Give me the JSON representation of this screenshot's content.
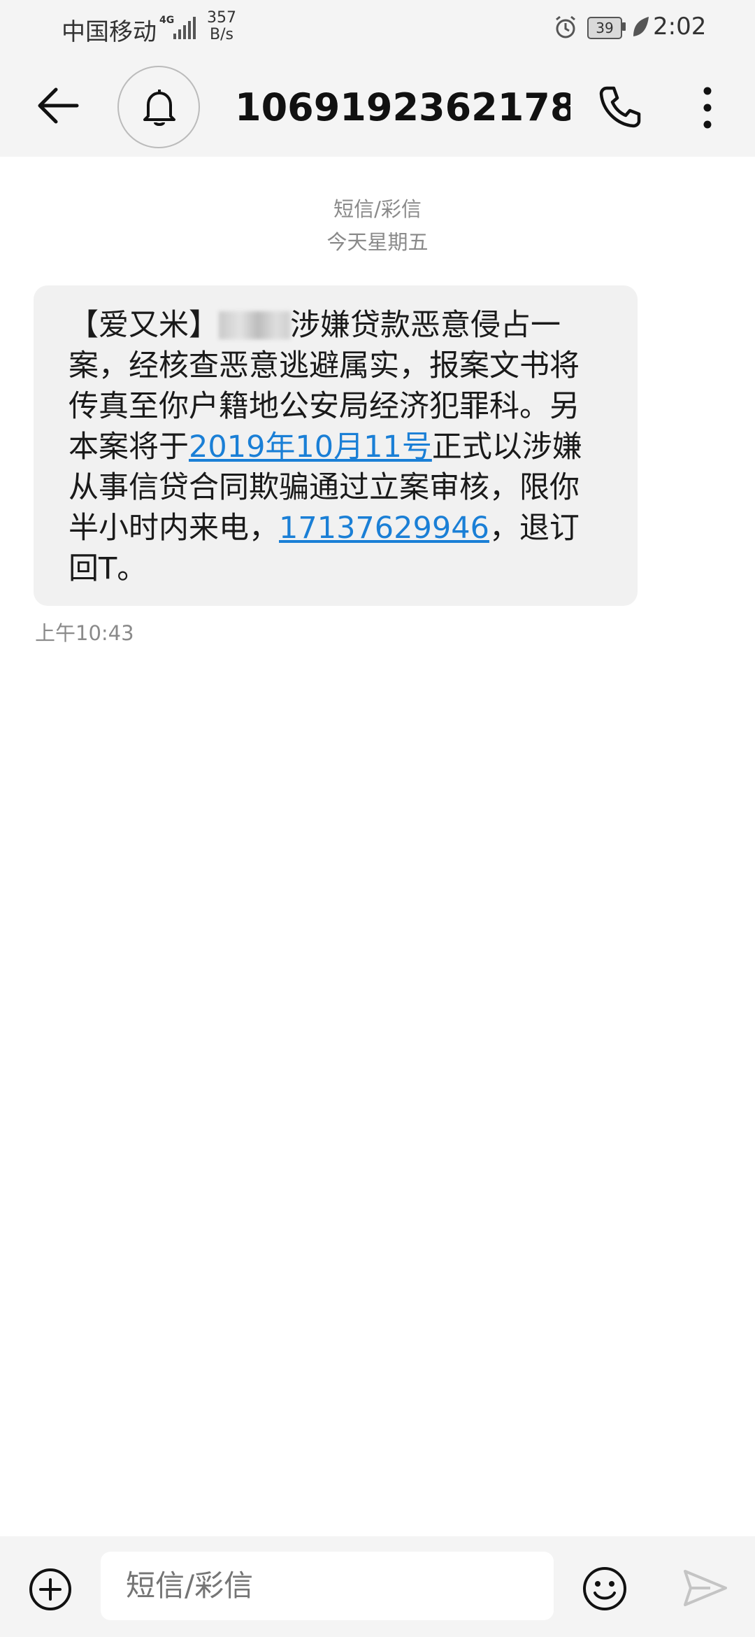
{
  "status_bar": {
    "carrier": "中国移动",
    "network": "4G",
    "speed_value": "357",
    "speed_unit": "B/s",
    "battery": "39",
    "time": "2:02"
  },
  "header": {
    "contact": "10691923621782..."
  },
  "conversation": {
    "message_type": "短信/彩信",
    "day": "今天星期五",
    "message": {
      "part1": "【爱又米】",
      "part2": "涉嫌贷款恶意侵占一案，经核查恶意逃避属实，报案文书将传真至你户籍地公安局经济犯罪科。另本案将于",
      "date_link": "2019年10月11号",
      "part3": "正式以涉嫌从事信贷合同欺骗通过立案审核，限你半小时内来电，",
      "phone_link": "17137629946",
      "part4": "，退订回T。"
    },
    "time": "上午10:43"
  },
  "composer": {
    "placeholder": "短信/彩信"
  },
  "icons": {
    "back": "back-arrow-icon",
    "bell": "bell-icon",
    "phone": "phone-icon",
    "more": "more-vertical-icon",
    "add": "add-circle-icon",
    "emoji": "emoji-icon",
    "send": "send-icon"
  },
  "colors": {
    "link": "#1a7fd6",
    "bar_bg": "#f4f4f4",
    "bubble_bg": "#f1f1f1"
  }
}
